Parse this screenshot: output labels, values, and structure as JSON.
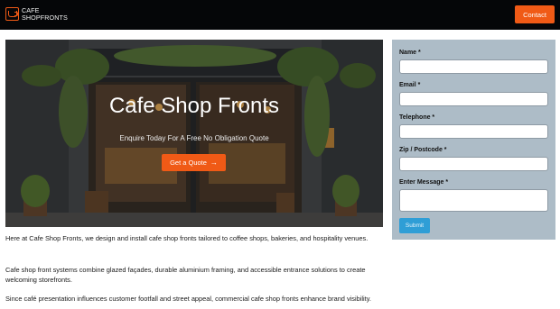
{
  "header": {
    "logo_line1": "CAFE",
    "logo_line2": "SHOPFRONTS",
    "contact_label": "Contact"
  },
  "hero": {
    "title": "Cafe Shop Fronts",
    "subtitle": "Enquire Today For A Free No Obligation Quote",
    "cta_label": "Get a Quote",
    "cta_icon": "arrow-right-icon"
  },
  "form": {
    "name_label": "Name *",
    "email_label": "Email *",
    "telephone_label": "Telephone *",
    "zip_label": "Zip / Postcode *",
    "message_label": "Enter Message *",
    "submit_label": "Submit"
  },
  "content": {
    "p1": "Here at Cafe Shop Fronts, we design and install cafe shop fronts tailored to coffee shops, bakeries, and hospitality venues.",
    "p2": "Cafe shop front systems combine glazed façades, durable aluminium framing, and accessible entrance solutions to create welcoming storefronts.",
    "p3": "Since café presentation influences customer footfall and street appeal, commercial cafe shop fronts enhance brand visibility."
  },
  "colors": {
    "accent": "#f05a16",
    "header_bg": "#050608",
    "form_bg": "#adbcc7",
    "submit_bg": "#2f9ed6"
  }
}
